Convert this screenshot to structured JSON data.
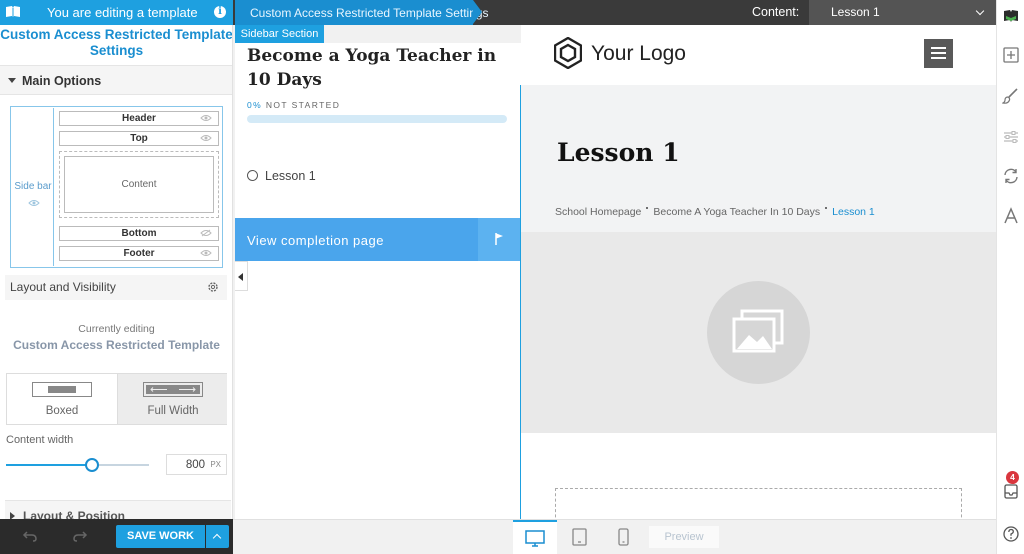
{
  "topbar": {
    "editing_label": "You are editing a template",
    "breadcrumb": "Custom Access Restricted Template Settings",
    "content_label": "Content:",
    "content_value": "Lesson 1"
  },
  "left_panel": {
    "title": "Custom Access Restricted Template Settings",
    "main_options": "Main Options",
    "layout_map": {
      "sidebar": "Side bar",
      "header": "Header",
      "top": "Top",
      "content": "Content",
      "bottom": "Bottom",
      "footer": "Footer"
    },
    "layout_visibility": "Layout and Visibility",
    "currently_editing_label": "Currently editing",
    "currently_editing_name": "Custom Access Restricted Template",
    "width_options": [
      "Boxed",
      "Full Width"
    ],
    "content_width_label": "Content width",
    "content_width_value": "800",
    "content_width_unit": "PX",
    "content_width_fraction": 0.6,
    "layout_position": "Layout & Position",
    "save_label": "SAVE WORK"
  },
  "canvas": {
    "sidebar_tag": "Sidebar Section",
    "course_title": "Become a Yoga Teacher in 10 Days",
    "progress_pct": "0%",
    "progress_status": "NOT STARTED",
    "lesson_item": "Lesson 1",
    "completion_button": "View completion page",
    "logo_text": "Your Logo",
    "lesson_title": "Lesson 1",
    "breadcrumbs": [
      "School Homepage",
      "Become A Yoga Teacher In 10 Days",
      "Lesson 1"
    ]
  },
  "bottom_bar": {
    "preview_label": "Preview"
  },
  "right_rail": {
    "notification_count": "4"
  },
  "colors": {
    "accent": "#1ea0e0",
    "accent_dark": "#1a8ed0",
    "completion_button": "#4aa5ec",
    "dark_bar": "#3a3a3a",
    "badge": "#d9363e"
  }
}
